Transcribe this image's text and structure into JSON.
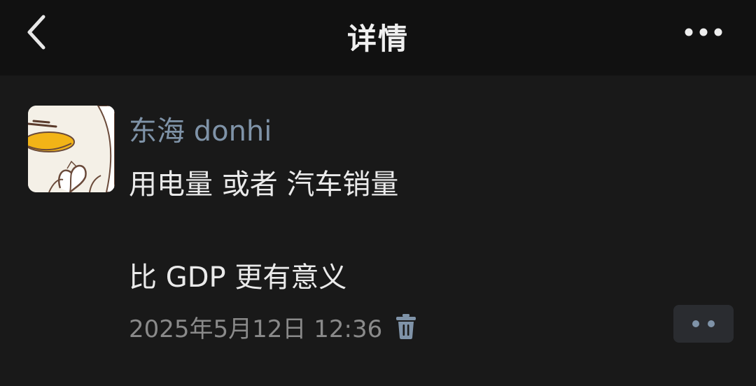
{
  "header": {
    "title": "详情",
    "back_icon": "chevron-left-icon",
    "more_icon": "more-horizontal-icon"
  },
  "post": {
    "username": "东海 donhi",
    "lines": [
      "用电量 或者 汽车销量",
      "比 GDP 更有意义"
    ],
    "timestamp": "2025年5月12日 12:36",
    "delete_icon": "trash-icon",
    "action_icon": "more-dots-icon"
  },
  "colors": {
    "background": "#191919",
    "header_background": "#111111",
    "username": "#7f93a8",
    "text": "#eaeaea",
    "timestamp": "#8a8a8a",
    "action_button": "#2a2c30"
  }
}
